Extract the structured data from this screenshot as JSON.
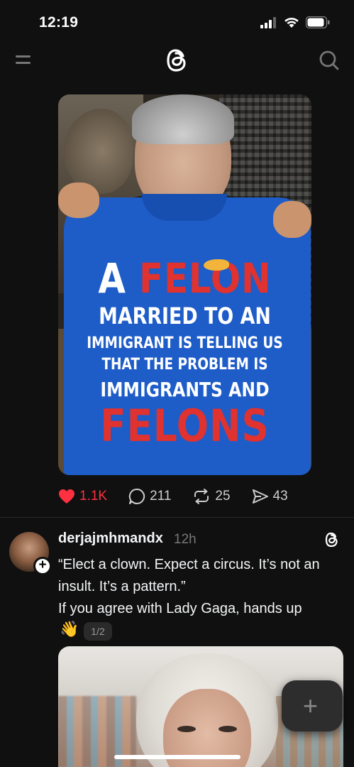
{
  "status_bar": {
    "time": "12:19",
    "icons": [
      "signal-icon",
      "wifi-icon",
      "battery-icon"
    ]
  },
  "nav": {
    "menu_icon": "menu-icon",
    "logo": "threads-logo-icon",
    "search_icon": "search-icon"
  },
  "post1": {
    "image_alt": "Man holding a blue t-shirt",
    "shirt_text": {
      "line1_a": "A ",
      "line1_b": "FELON",
      "line2": "MARRIED TO AN",
      "line3": "IMMIGRANT IS TELLING US",
      "line4": "THAT THE PROBLEM IS",
      "line5": "IMMIGRANTS AND",
      "line6": "FELONS"
    },
    "actions": {
      "likes": "1.1K",
      "comments": "211",
      "reposts": "25",
      "shares": "43"
    }
  },
  "post2": {
    "username": "derjajmhmandx",
    "time": "12h",
    "text_line1": "“Elect a clown. Expect a circus. It’s not an insult. It’s a pattern.”",
    "text_line2": "If you agree with Lady Gaga, hands up",
    "emoji": "👋",
    "page_indicator": "1/2"
  },
  "fab": {
    "label": "+"
  },
  "colors": {
    "background": "#101010",
    "like_red": "#ff3040",
    "text_primary": "#f3f5f7",
    "text_secondary": "#777777",
    "shirt_blue": "#1e5cc8",
    "shirt_red": "#e0322f"
  }
}
